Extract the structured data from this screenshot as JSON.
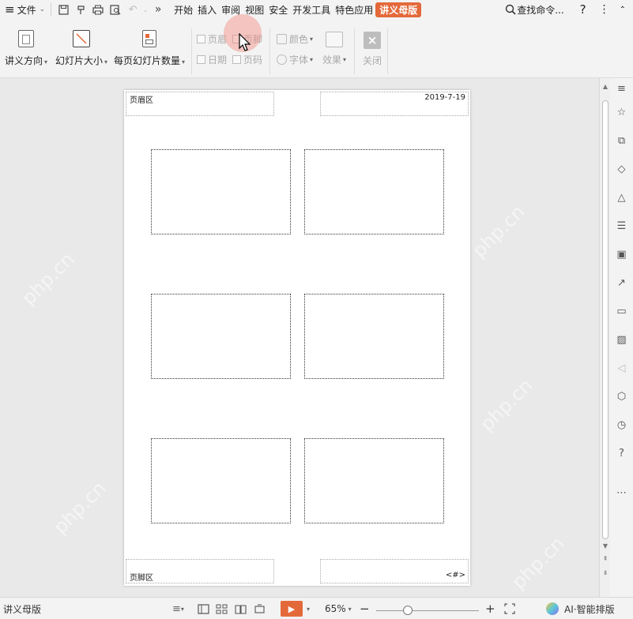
{
  "menubar": {
    "menu_label": "文件",
    "tabs": [
      "开始",
      "插入",
      "审阅",
      "视图",
      "安全",
      "开发工具",
      "特色应用"
    ],
    "active_tab": "讲义母版",
    "search_label": "查找命令...",
    "help_label": "?",
    "more_label": "⋮",
    "overflow_label": "»",
    "hamburger": "≡"
  },
  "ribbon": {
    "orientation_label": "讲义方向",
    "slide_size_label": "幻灯片大小",
    "per_page_label": "每页幻灯片数量",
    "header_label": "页眉",
    "footer_label": "页脚",
    "date_label": "日期",
    "page_number_label": "页码",
    "color_label": "颜色",
    "font_label": "字体",
    "effect_label": "效果",
    "close_label": "关闭"
  },
  "page": {
    "header_area": "页眉区",
    "date": "2019-7-19",
    "footer_area": "页脚区",
    "page_number": "<#>"
  },
  "watermark": "php.cn",
  "status": {
    "view_label": "讲义母版",
    "zoom": "65%",
    "zoom_level_percent": 65,
    "minus": "−",
    "plus": "+",
    "ai_label": "AI·智能排版"
  },
  "colors": {
    "accent": "#e4693a",
    "background": "#e9e9e9",
    "toolbar": "#f3f3f3"
  }
}
